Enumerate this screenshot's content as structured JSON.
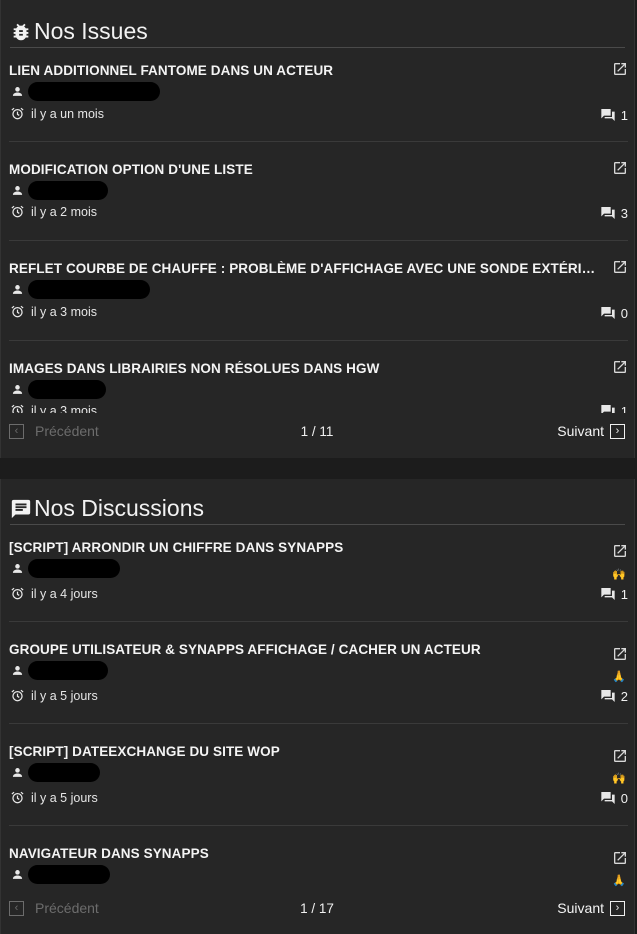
{
  "issues": {
    "title": "Nos Issues",
    "items": [
      {
        "title": "LIEN ADDITIONNEL FANTOME DANS UN ACTEUR",
        "time": "il y a un mois",
        "comments": "1"
      },
      {
        "title": "MODIFICATION OPTION D'UNE LISTE",
        "time": "il y a 2 mois",
        "comments": "3"
      },
      {
        "title": "REFLET COURBE DE CHAUFFE : PROBLÈME D'AFFICHAGE AVEC UNE SONDE EXTÉRIEURE",
        "time": "il y a 3 mois",
        "comments": "0"
      },
      {
        "title": "IMAGES DANS LIBRAIRIES NON RÉSOLUES DANS HGW",
        "time": "il y a 3 mois",
        "comments": "1"
      }
    ],
    "pager": {
      "prev": "Précédent",
      "info": "1 / 11",
      "next": "Suivant"
    }
  },
  "discussions": {
    "title": "Nos Discussions",
    "items": [
      {
        "title": "[SCRIPT] ARRONDIR UN CHIFFRE DANS SYNAPPS",
        "time": "il y a 4 jours",
        "comments": "1",
        "emoji": "🙌"
      },
      {
        "title": "GROUPE UTILISATEUR & SYNAPPS AFFICHAGE / CACHER UN ACTEUR",
        "time": "il y a 5 jours",
        "comments": "2",
        "emoji": "🙏"
      },
      {
        "title": "[SCRIPT] DATEEXCHANGE DU SITE WOP",
        "time": "il y a 5 jours",
        "comments": "0",
        "emoji": "🙌"
      },
      {
        "title": "NAVIGATEUR DANS SYNAPPS",
        "time": "",
        "comments": "",
        "emoji": "🙏"
      }
    ],
    "pager": {
      "prev": "Précédent",
      "info": "1 / 17",
      "next": "Suivant"
    }
  },
  "colors": {
    "panel": "#262626",
    "background": "#1c1c1c",
    "accent_emoji": "#e0a020"
  }
}
